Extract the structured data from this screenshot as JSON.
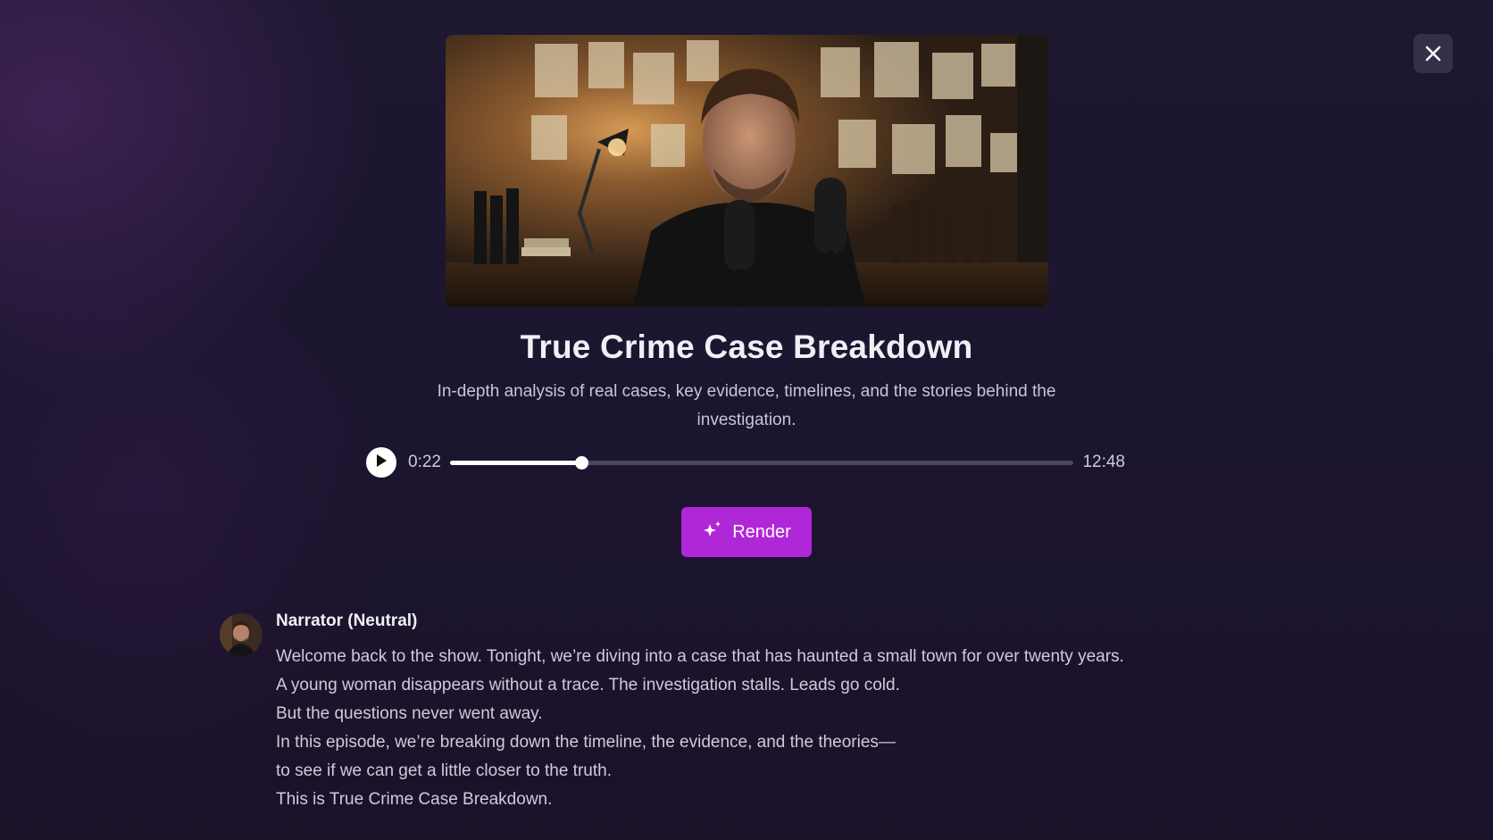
{
  "window": {
    "close_icon": "close-icon"
  },
  "hero": {
    "image": "podcast-host-studio-photo"
  },
  "episode": {
    "title": "True Crime Case Breakdown",
    "description": "In-depth analysis of real cases, key evidence, timelines, and the stories behind the investigation."
  },
  "player": {
    "play_icon": "play-icon",
    "current_time": "0:22",
    "total_time": "12:48",
    "progress": 0.21
  },
  "render": {
    "icon": "sparkle-icon",
    "label": "Render"
  },
  "transcript": {
    "speaker": "Narrator (Neutral)",
    "lines": [
      "Welcome back to the show. Tonight, we’re diving into a case that has haunted a small town for over twenty years.",
      "A young woman disappears without a trace. The investigation stalls. Leads go cold.",
      "But the questions never went away.",
      "In this episode, we’re breaking down the timeline, the evidence, and the theories—",
      "to see if we can get a little closer to the truth.",
      "This is True Crime Case Breakdown."
    ]
  },
  "colors": {
    "accent": "#b027d7",
    "background": "#1c1530"
  }
}
